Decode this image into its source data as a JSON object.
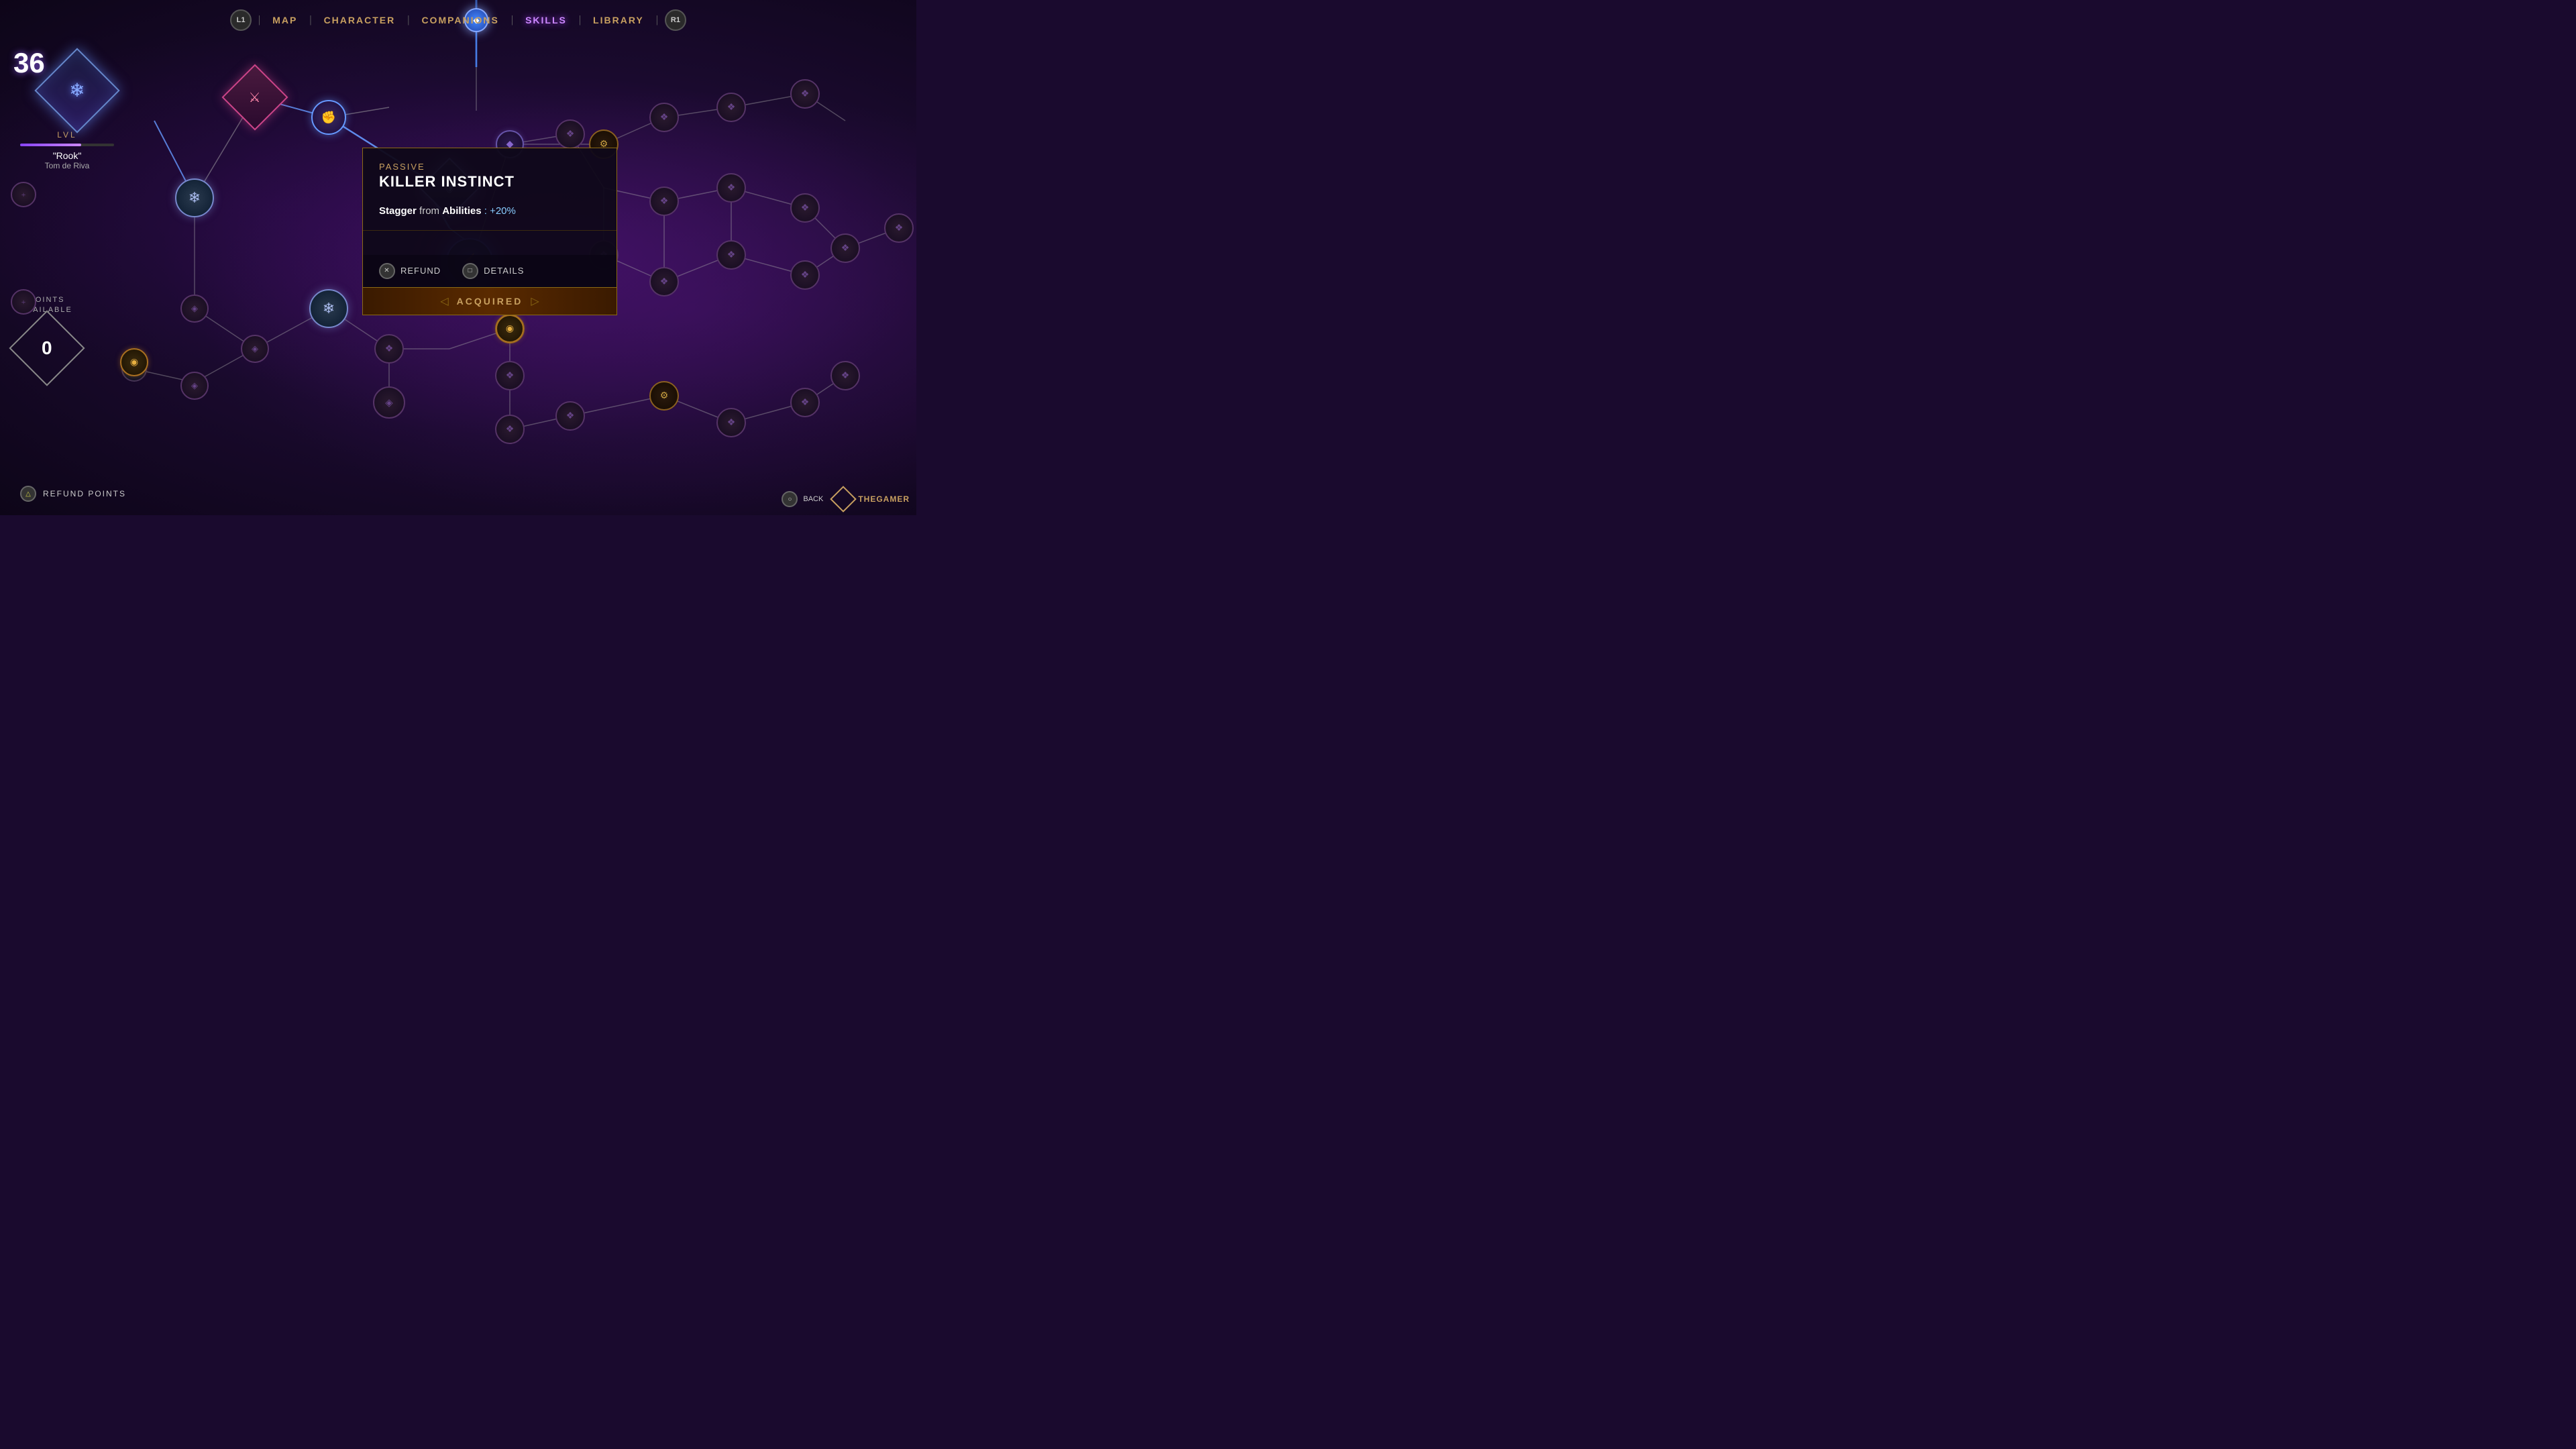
{
  "nav": {
    "l1": "L1",
    "r1": "R1",
    "items": [
      {
        "id": "map",
        "label": "MAP",
        "active": false
      },
      {
        "id": "character",
        "label": "CHARACTER",
        "active": false
      },
      {
        "id": "companions",
        "label": "COMPANIONS",
        "active": false
      },
      {
        "id": "skills",
        "label": "SKILLS",
        "active": true
      },
      {
        "id": "library",
        "label": "LIBRARY",
        "active": false
      }
    ]
  },
  "player": {
    "level": "36",
    "lvl_label": "LVL",
    "name": "\"Rook\"",
    "subtitle": "Tom de Riva"
  },
  "points": {
    "label": "POINTS\nAVAILABLE",
    "value": "0"
  },
  "tooltip": {
    "type": "PASSIVE",
    "title": "KILLER INSTINCT",
    "description_prefix": "Stagger",
    "description_middle": " from ",
    "description_keyword": "Abilities",
    "description_suffix": ": +20%",
    "refund_label": "REFUND",
    "details_label": "DETAILS",
    "acquired_label": "ACQUIRED"
  },
  "bottom": {
    "refund_points_label": "REFUND POINTS",
    "back_label": "BACK"
  },
  "colors": {
    "accent_gold": "#c8a060",
    "accent_purple": "#cc88ff",
    "accent_blue": "#6699ff",
    "node_active": "#8866ff",
    "bg_dark": "#1a0a2e"
  }
}
